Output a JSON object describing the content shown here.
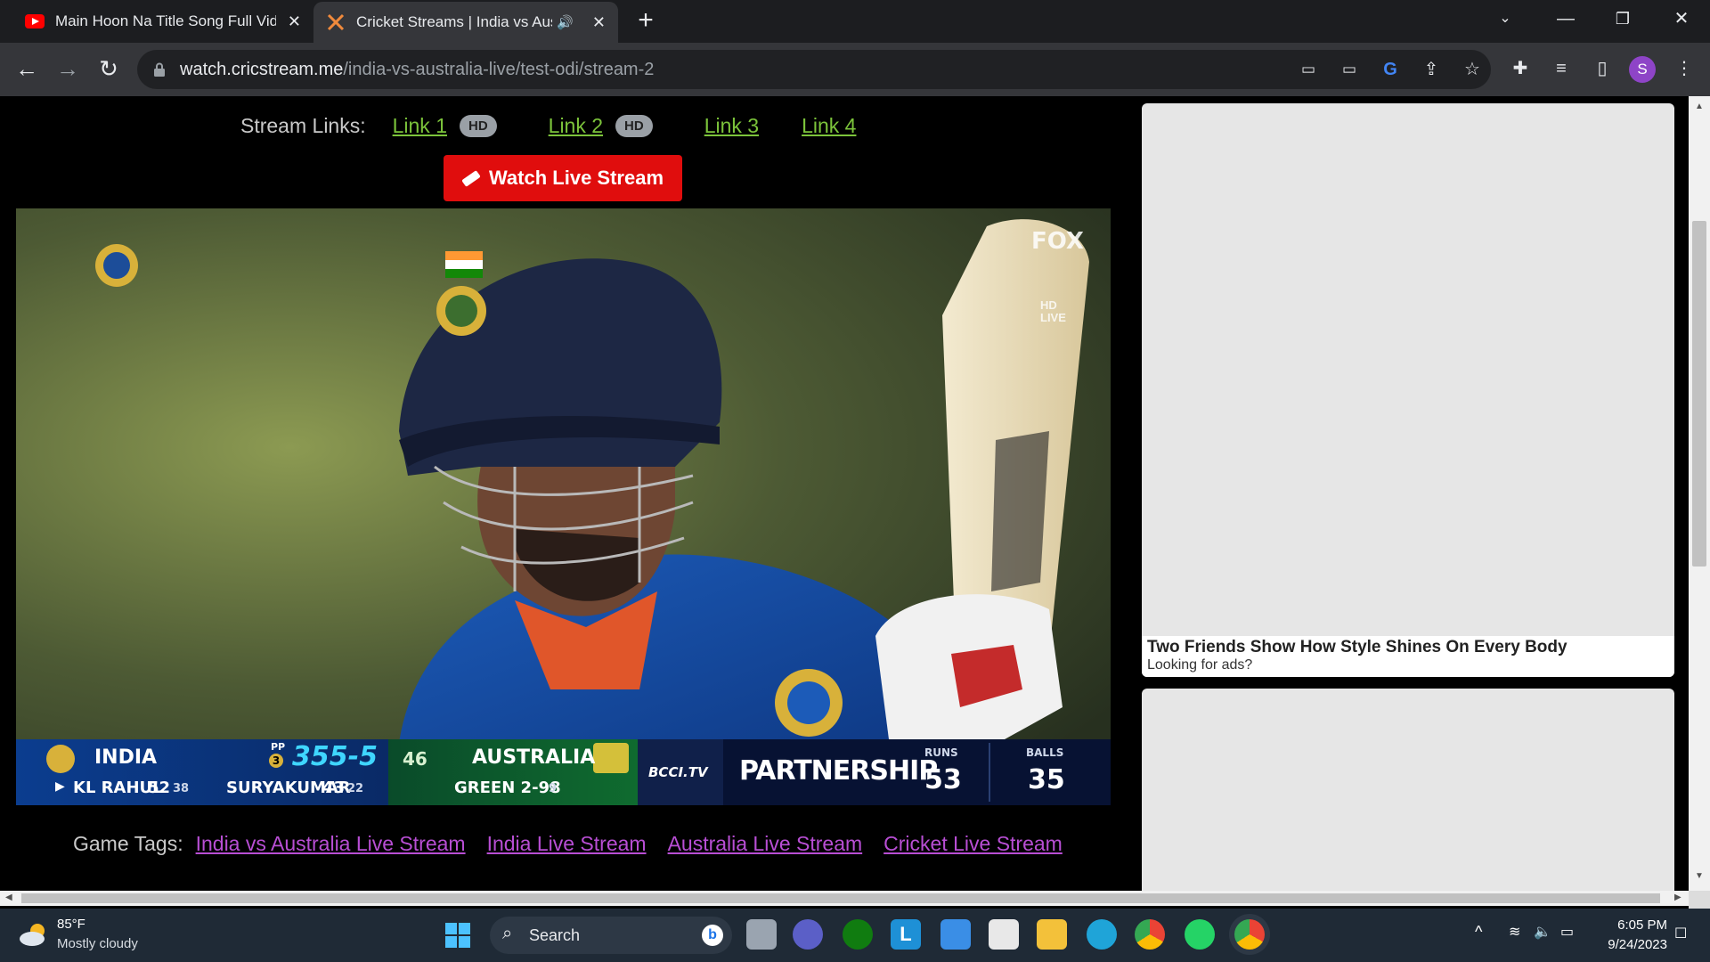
{
  "browser": {
    "tabs": [
      {
        "title": "Main Hoon Na Title Song Full Video",
        "active": false
      },
      {
        "title": "Cricket Streams | India vs Australia",
        "active": true
      }
    ],
    "url_host": "watch.cricstream.me",
    "url_path": "/india-vs-australia-live/test-odi/stream-2",
    "profile_initial": "S"
  },
  "page": {
    "stream_links_label": "Stream Links:",
    "links": [
      {
        "label": "Link 1",
        "badge": "HD"
      },
      {
        "label": "Link 2",
        "badge": "HD"
      },
      {
        "label": "Link 3",
        "badge": ""
      },
      {
        "label": "Link 4",
        "badge": ""
      }
    ],
    "watch_button": "Watch Live Stream",
    "game_tags_label": "Game Tags:",
    "game_tags": [
      "India vs Australia Live Stream",
      "India Live Stream",
      "Australia Live Stream",
      "Cricket Live Stream"
    ],
    "ad": {
      "title": "Two Friends Show How Style Shines On Every Body",
      "subtitle": "Looking for ads?"
    }
  },
  "scoreboard": {
    "batting_team": "INDIA",
    "pp_label": "PP",
    "pp_number": "3",
    "score": "355-5",
    "overs": "46",
    "bowling_team": "AUSTRALIA",
    "batter1_name": "KL RAHUL",
    "batter1_runs": "52",
    "batter1_balls": "38",
    "batter2_name": "SURYAKUMAR",
    "batter2_runs": "43",
    "batter2_balls": "22",
    "bowler": "GREEN 2-98",
    "bowler_overs": "9",
    "broadcaster": "BCCI.TV",
    "partnership_label": "PARTNERSHIP",
    "runs_label": "RUNS",
    "runs": "53",
    "balls_label": "BALLS",
    "balls": "35",
    "watermark_lines": [
      "HD",
      "LIVE"
    ]
  },
  "taskbar": {
    "weather_temp": "85°F",
    "weather_desc": "Mostly cloudy",
    "search_label": "Search",
    "time": "6:05 PM",
    "date": "9/24/2023"
  },
  "colors": {
    "link_green": "#7cc43b",
    "tag_purple": "#b84ed4",
    "watch_red": "#e00d0d"
  }
}
